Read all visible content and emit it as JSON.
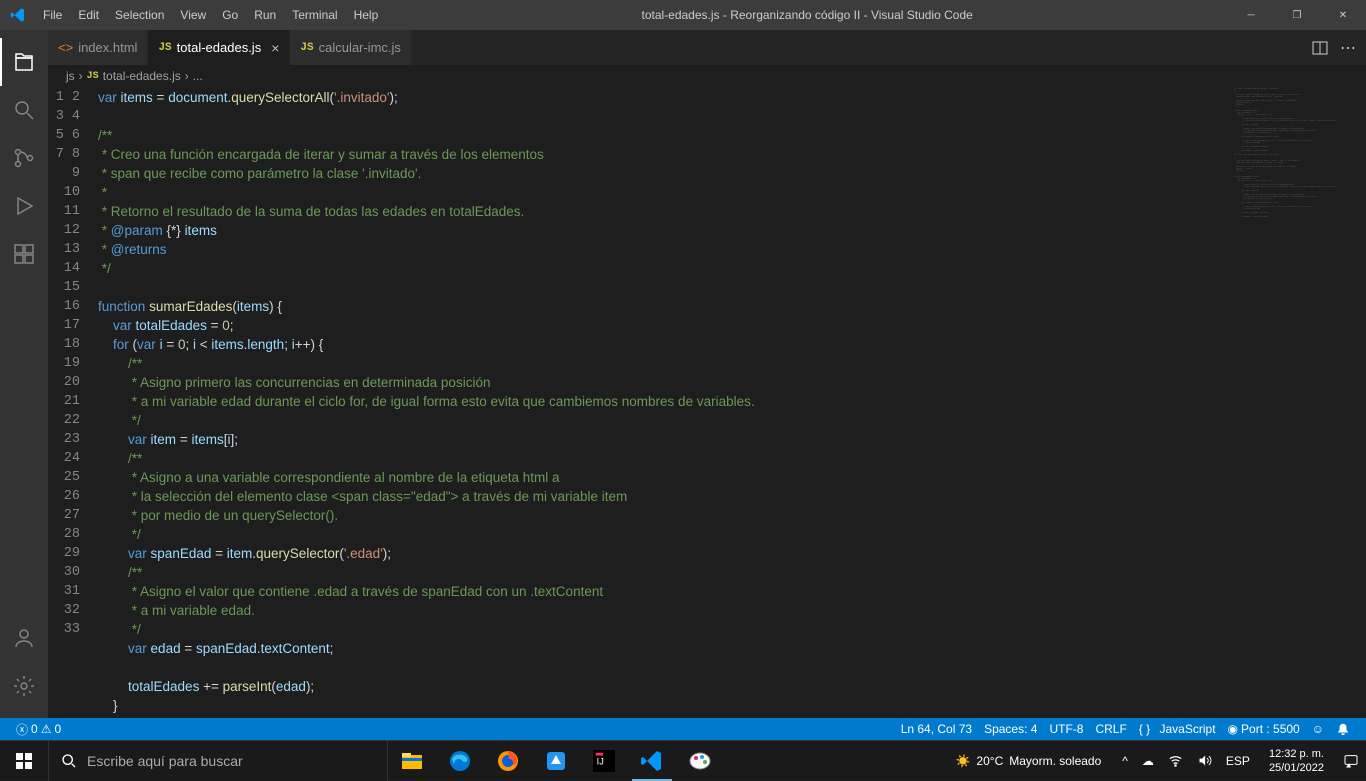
{
  "titlebar": {
    "title": "total-edades.js - Reorganizando código II - Visual Studio Code",
    "menu": [
      "File",
      "Edit",
      "Selection",
      "View",
      "Go",
      "Run",
      "Terminal",
      "Help"
    ]
  },
  "tabs": [
    {
      "icon": "html",
      "label": "index.html",
      "active": false,
      "close": false
    },
    {
      "icon": "js",
      "label": "total-edades.js",
      "active": true,
      "close": true
    },
    {
      "icon": "js",
      "label": "calcular-imc.js",
      "active": false,
      "close": false
    }
  ],
  "breadcrumb": {
    "folder": "js",
    "file": "total-edades.js",
    "more": "..."
  },
  "gutter_start": 1,
  "gutter_end": 33,
  "statusbar": {
    "errors": "0",
    "warnings": "0",
    "ln_col": "Ln 64, Col 73",
    "spaces": "Spaces: 4",
    "encoding": "UTF-8",
    "eol": "CRLF",
    "lang_icon": "{ }",
    "lang": "JavaScript",
    "port": "Port : 5500",
    "feedback": "☺",
    "bell": "🔔"
  },
  "taskbar": {
    "search_placeholder": "Escribe aquí para buscar",
    "weather_temp": "20°C",
    "weather_desc": "Mayorm. soleado",
    "lang": "ESP",
    "time": "12:32 p. m.",
    "date": "25/01/2022"
  },
  "code_lines": [
    [
      [
        "k",
        "var"
      ],
      [
        "p",
        " "
      ],
      [
        "v",
        "items"
      ],
      [
        "p",
        " = "
      ],
      [
        "v",
        "document"
      ],
      [
        "p",
        "."
      ],
      [
        "f",
        "querySelectorAll"
      ],
      [
        "p",
        "("
      ],
      [
        "s",
        "'.invitado'"
      ],
      [
        "p",
        ");"
      ]
    ],
    [],
    [
      [
        "c",
        "/**"
      ]
    ],
    [
      [
        "c",
        " * Creo una función encargada de iterar y sumar a través de los elementos"
      ]
    ],
    [
      [
        "c",
        " * span que recibe como parámetro la clase '.invitado'."
      ]
    ],
    [
      [
        "c",
        " *"
      ]
    ],
    [
      [
        "c",
        " * Retorno el resultado de la suma de todas las edades en totalEdades."
      ]
    ],
    [
      [
        "c",
        " * "
      ],
      [
        "t",
        "@param"
      ],
      [
        "c",
        " "
      ],
      [
        "p",
        "{*}"
      ],
      [
        "c",
        " "
      ],
      [
        "pa",
        "items"
      ]
    ],
    [
      [
        "c",
        " * "
      ],
      [
        "t",
        "@returns"
      ]
    ],
    [
      [
        "c",
        " */"
      ]
    ],
    [],
    [
      [
        "k",
        "function"
      ],
      [
        "p",
        " "
      ],
      [
        "f",
        "sumarEdades"
      ],
      [
        "p",
        "("
      ],
      [
        "v",
        "items"
      ],
      [
        "p",
        ") {"
      ]
    ],
    [
      [
        "p",
        "    "
      ],
      [
        "k",
        "var"
      ],
      [
        "p",
        " "
      ],
      [
        "v",
        "totalEdades"
      ],
      [
        "p",
        " = "
      ],
      [
        "n",
        "0"
      ],
      [
        "p",
        ";"
      ]
    ],
    [
      [
        "p",
        "    "
      ],
      [
        "k",
        "for"
      ],
      [
        "p",
        " ("
      ],
      [
        "k",
        "var"
      ],
      [
        "p",
        " "
      ],
      [
        "v",
        "i"
      ],
      [
        "p",
        " = "
      ],
      [
        "n",
        "0"
      ],
      [
        "p",
        "; "
      ],
      [
        "v",
        "i"
      ],
      [
        "p",
        " < "
      ],
      [
        "v",
        "items"
      ],
      [
        "p",
        "."
      ],
      [
        "v",
        "length"
      ],
      [
        "p",
        "; "
      ],
      [
        "v",
        "i"
      ],
      [
        "p",
        "++) {"
      ]
    ],
    [
      [
        "p",
        "        "
      ],
      [
        "c",
        "/**"
      ]
    ],
    [
      [
        "p",
        "        "
      ],
      [
        "c",
        " * Asigno primero las concurrencias en determinada posición"
      ]
    ],
    [
      [
        "p",
        "        "
      ],
      [
        "c",
        " * a mi variable edad durante el ciclo for, de igual forma esto evita que cambiemos nombres de variables."
      ]
    ],
    [
      [
        "p",
        "        "
      ],
      [
        "c",
        " */"
      ]
    ],
    [
      [
        "p",
        "        "
      ],
      [
        "k",
        "var"
      ],
      [
        "p",
        " "
      ],
      [
        "v",
        "item"
      ],
      [
        "p",
        " = "
      ],
      [
        "v",
        "items"
      ],
      [
        "p",
        "["
      ],
      [
        "v",
        "i"
      ],
      [
        "p",
        "];"
      ]
    ],
    [
      [
        "p",
        "        "
      ],
      [
        "c",
        "/**"
      ]
    ],
    [
      [
        "p",
        "        "
      ],
      [
        "c",
        " * Asigno a una variable correspondiente al nombre de la etiqueta html a"
      ]
    ],
    [
      [
        "p",
        "        "
      ],
      [
        "c",
        " * la selección del elemento clase <span class=\"edad\"> a través de mi variable item"
      ]
    ],
    [
      [
        "p",
        "        "
      ],
      [
        "c",
        " * por medio de un querySelector()."
      ]
    ],
    [
      [
        "p",
        "        "
      ],
      [
        "c",
        " */"
      ]
    ],
    [
      [
        "p",
        "        "
      ],
      [
        "k",
        "var"
      ],
      [
        "p",
        " "
      ],
      [
        "v",
        "spanEdad"
      ],
      [
        "p",
        " = "
      ],
      [
        "v",
        "item"
      ],
      [
        "p",
        "."
      ],
      [
        "f",
        "querySelector"
      ],
      [
        "p",
        "("
      ],
      [
        "s",
        "'.edad'"
      ],
      [
        "p",
        ");"
      ]
    ],
    [
      [
        "p",
        "        "
      ],
      [
        "c",
        "/**"
      ]
    ],
    [
      [
        "p",
        "        "
      ],
      [
        "c",
        " * Asigno el valor que contiene .edad a través de spanEdad con un .textContent"
      ]
    ],
    [
      [
        "p",
        "        "
      ],
      [
        "c",
        " * a mi variable edad."
      ]
    ],
    [
      [
        "p",
        "        "
      ],
      [
        "c",
        " */"
      ]
    ],
    [
      [
        "p",
        "        "
      ],
      [
        "k",
        "var"
      ],
      [
        "p",
        " "
      ],
      [
        "v",
        "edad"
      ],
      [
        "p",
        " = "
      ],
      [
        "v",
        "spanEdad"
      ],
      [
        "p",
        "."
      ],
      [
        "v",
        "textContent"
      ],
      [
        "p",
        ";"
      ]
    ],
    [],
    [
      [
        "p",
        "        "
      ],
      [
        "v",
        "totalEdades"
      ],
      [
        "p",
        " += "
      ],
      [
        "f",
        "parseInt"
      ],
      [
        "p",
        "("
      ],
      [
        "v",
        "edad"
      ],
      [
        "p",
        ");"
      ]
    ],
    [
      [
        "p",
        "    }"
      ]
    ]
  ]
}
